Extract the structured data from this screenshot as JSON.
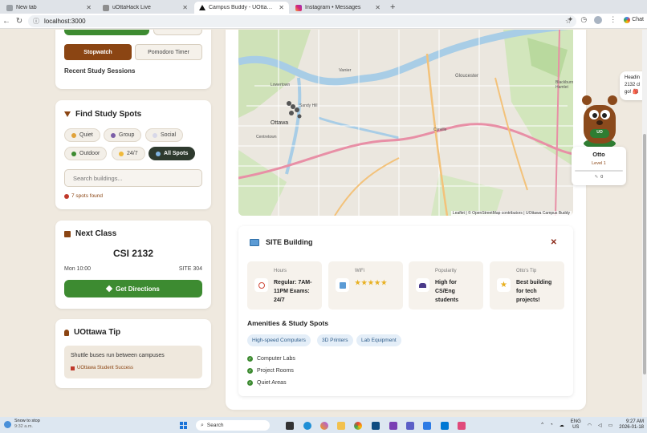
{
  "browser": {
    "tabs": [
      {
        "label": "New tab",
        "active": false
      },
      {
        "label": "uOttaHack Live",
        "active": false
      },
      {
        "label": "Campus Buddy - UOttawa Study S",
        "active": true
      },
      {
        "label": "Instagram • Messages",
        "active": false
      }
    ],
    "new_tab_icon": "+",
    "url": "localhost:3000"
  },
  "top": {
    "stopwatch_label": "Stopwatch",
    "pomodoro_label": "Pomodoro Timer",
    "recent_sessions": "Recent Study Sessions"
  },
  "find": {
    "title": "Find Study Spots",
    "chips": [
      "Quiet",
      "Group",
      "Social",
      "Outdoor",
      "24/7",
      "All Spots"
    ],
    "search_placeholder": "Search buildings...",
    "count": "7 spots found"
  },
  "next_class": {
    "title": "Next Class",
    "course": "CSI 2132",
    "time": "Mon 10:00",
    "room": "SITE 304",
    "directions": "Get Directions"
  },
  "tip": {
    "title": "UOttawa Tip",
    "text": "Shuttle buses run between campuses",
    "source": "UOttawa Student Success"
  },
  "map": {
    "labels": [
      "Ottawa",
      "Vanier",
      "Gloucester",
      "Lowertown",
      "Centretown",
      "Sandy Hill",
      "Cyrville",
      "Blackburn Hamlet"
    ],
    "attribution": "Leaflet | © OpenStreetMap contributors | UOttawa Campus Buddy"
  },
  "building": {
    "name": "SITE Building",
    "close": "✕",
    "info": [
      {
        "label": "Hours",
        "value": "Regular: 7AM-11PM Exams: 24/7",
        "icon": "clock-icon"
      },
      {
        "label": "WiFi",
        "value": "★★★★★",
        "icon": "wifi-icon"
      },
      {
        "label": "Popularity",
        "value": "High for CS/Eng students",
        "icon": "people-icon"
      },
      {
        "label": "Otto's Tip",
        "value": "Best building for tech projects!",
        "icon": "star-icon"
      }
    ],
    "amenities_title": "Amenities & Study Spots",
    "amenities": [
      "High-speed Computers",
      "3D Printers",
      "Lab Equipment"
    ],
    "features": [
      "Computer Labs",
      "Project Rooms",
      "Quiet Areas"
    ]
  },
  "otto": {
    "bubble": "Headin 2132 cl go! 🎒",
    "badge": "UO",
    "name": "Otto",
    "level": "Level 1",
    "points": "0"
  },
  "taskbar": {
    "weather_title": "Snow to stop",
    "weather_time": "9:32 a.m.",
    "search": "Search",
    "lang1": "ENG",
    "lang2": "US",
    "time": "9:27 AM",
    "date": "2026-01-18"
  },
  "colors": {
    "green": "#3d8b31",
    "brown": "#8b4513",
    "page_bg": "#efe9df"
  }
}
